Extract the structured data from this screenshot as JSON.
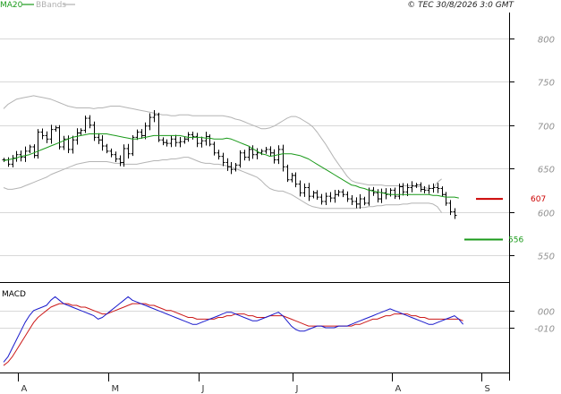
{
  "header": {
    "legend": [
      {
        "label": "MA20",
        "color": "#1a9a1a"
      },
      {
        "label": "BBands",
        "color": "#b0b0b0"
      }
    ],
    "copyright": "© TEC 30/8/2026 3:0 GMT"
  },
  "colors": {
    "ma20": "#1a9a1a",
    "bbands": "#b4b4b4",
    "candles": "#000000",
    "resistance": "#cc0000",
    "support": "#1a9a1a",
    "macd": "#1a1acc",
    "signal": "#cc1a1a",
    "grid": "#d8d8d8"
  },
  "chart_data": [
    {
      "type": "candlestick",
      "title": "",
      "ylim": [
        520,
        830
      ],
      "yticks": [
        "800",
        "750",
        "700",
        "650",
        "600",
        "550"
      ],
      "ytick_values": [
        800,
        750,
        700,
        650,
        600,
        550
      ],
      "grid": true,
      "x_months": [
        "A",
        "M",
        "J",
        "J",
        "A",
        "S"
      ],
      "month_index": [
        0,
        21,
        42,
        64,
        87,
        108
      ],
      "series": [
        {
          "name": "MA20",
          "values": [
            659,
            660,
            661,
            662,
            664,
            665,
            666,
            668,
            670,
            672,
            674,
            676,
            678,
            680,
            682,
            684,
            686,
            687,
            688,
            689,
            690,
            690,
            690,
            690,
            690,
            689,
            688,
            687,
            686,
            685,
            684,
            684,
            685,
            686,
            687,
            688,
            688,
            688,
            688,
            688,
            688,
            688,
            687,
            686,
            686,
            686,
            686,
            685,
            685,
            684,
            684,
            684,
            685,
            684,
            682,
            680,
            678,
            676,
            673,
            670,
            667,
            666,
            664,
            665,
            666,
            667,
            667,
            667,
            666,
            665,
            663,
            661,
            658,
            655,
            652,
            649,
            646,
            643,
            640,
            637,
            634,
            631,
            630,
            628,
            627,
            625,
            624,
            623,
            622,
            621,
            620,
            620,
            620,
            620,
            620,
            620,
            620,
            620,
            620,
            620,
            619,
            619,
            618,
            617,
            617,
            617,
            616
          ]
        },
        {
          "name": "BBands upper",
          "values": [
            719,
            724,
            727,
            730,
            731,
            732,
            733,
            734,
            733,
            732,
            731,
            730,
            728,
            726,
            724,
            722,
            721,
            720,
            720,
            720,
            720,
            719,
            720,
            720,
            721,
            722,
            722,
            722,
            721,
            720,
            719,
            718,
            717,
            716,
            715,
            714,
            713,
            712,
            712,
            711,
            711,
            712,
            712,
            712,
            711,
            711,
            711,
            711,
            711,
            711,
            711,
            711,
            710,
            709,
            707,
            706,
            704,
            702,
            700,
            698,
            696,
            696,
            697,
            699,
            702,
            705,
            708,
            710,
            710,
            708,
            705,
            702,
            698,
            692,
            685,
            678,
            670,
            662,
            655,
            648,
            641,
            636,
            634,
            633,
            632,
            631,
            631,
            631,
            631,
            630,
            630,
            630,
            630,
            630,
            630,
            630,
            629,
            629,
            628,
            627,
            627,
            634,
            638
          ]
        },
        {
          "name": "BBands lower",
          "values": [
            628,
            626,
            626,
            627,
            628,
            630,
            632,
            634,
            636,
            638,
            640,
            643,
            645,
            647,
            649,
            651,
            653,
            655,
            656,
            657,
            658,
            658,
            658,
            658,
            658,
            657,
            656,
            656,
            655,
            655,
            655,
            655,
            656,
            657,
            658,
            659,
            659,
            660,
            660,
            661,
            661,
            662,
            663,
            663,
            661,
            659,
            657,
            656,
            656,
            655,
            655,
            654,
            653,
            652,
            650,
            648,
            646,
            644,
            642,
            640,
            636,
            631,
            627,
            625,
            624,
            624,
            622,
            620,
            617,
            614,
            611,
            608,
            606,
            605,
            604,
            604,
            604,
            604,
            604,
            604,
            604,
            604,
            604,
            605,
            605,
            606,
            606,
            607,
            607,
            608,
            608,
            608,
            608,
            609,
            609,
            610,
            610,
            610,
            610,
            610,
            609,
            606,
            599
          ]
        },
        {
          "name": "Candles",
          "values": [
            660,
            655,
            662,
            666,
            663,
            670,
            675,
            665,
            692,
            688,
            684,
            695,
            697,
            675,
            684,
            672,
            683,
            691,
            694,
            708,
            700,
            686,
            683,
            676,
            670,
            666,
            661,
            657,
            673,
            667,
            686,
            692,
            688,
            699,
            709,
            712,
            683,
            680,
            679,
            684,
            680,
            681,
            684,
            689,
            687,
            679,
            682,
            687,
            678,
            668,
            664,
            657,
            652,
            649,
            654,
            668,
            663,
            672,
            666,
            668,
            670,
            672,
            668,
            660,
            672,
            652,
            637,
            642,
            632,
            622,
            628,
            618,
            622,
            617,
            612,
            618,
            616,
            620,
            623,
            620,
            615,
            612,
            609,
            615,
            610,
            625,
            622,
            615,
            622,
            620,
            625,
            618,
            629,
            623,
            628,
            630,
            631,
            626,
            625,
            627,
            628,
            627,
            620,
            610,
            600,
            596
          ]
        }
      ],
      "annotations": [
        {
          "label": "607",
          "value": 615,
          "color": "#cc0000"
        },
        {
          "label": "556",
          "value": 568,
          "color": "#1a9a1a"
        }
      ]
    },
    {
      "type": "line",
      "title": "MACD",
      "ylim": [
        -35,
        15
      ],
      "yticks": [
        "000",
        "-010"
      ],
      "ytick_values": [
        0,
        -10
      ],
      "grid": true,
      "series": [
        {
          "name": "",
          "values": [
            -30,
            -27,
            -22,
            -17,
            -12,
            -7,
            -3,
            0,
            1,
            2,
            3,
            6,
            8,
            6,
            4,
            3,
            2,
            1,
            0,
            -1,
            -2,
            -3,
            -5,
            -4,
            -2,
            0,
            2,
            4,
            6,
            8,
            6,
            5,
            4,
            3,
            2,
            1,
            0,
            -1,
            -2,
            -3,
            -4,
            -5,
            -6,
            -7,
            -8,
            -8,
            -7,
            -6,
            -5,
            -4,
            -3,
            -2,
            -1,
            -1,
            -2,
            -3,
            -4,
            -5,
            -6,
            -6,
            -5,
            -4,
            -3,
            -2,
            -1,
            -3,
            -6,
            -9,
            -11,
            -12,
            -12,
            -11,
            -10,
            -9,
            -9,
            -10,
            -10,
            -10,
            -9,
            -9,
            -9,
            -8,
            -7,
            -6,
            -5,
            -4,
            -3,
            -2,
            -1,
            0,
            1,
            0,
            -1,
            -2,
            -3,
            -4,
            -5,
            -6,
            -7,
            -8,
            -8,
            -7,
            -6,
            -5,
            -4,
            -3,
            -5,
            -8
          ]
        },
        {
          "name": "",
          "values": [
            -32,
            -30,
            -27,
            -23,
            -19,
            -15,
            -11,
            -7,
            -4,
            -2,
            0,
            2,
            3,
            4,
            4,
            4,
            3,
            3,
            2,
            2,
            1,
            0,
            -1,
            -2,
            -2,
            -1,
            0,
            1,
            2,
            3,
            4,
            4,
            4,
            4,
            3,
            3,
            2,
            1,
            0,
            0,
            -1,
            -2,
            -3,
            -4,
            -4,
            -5,
            -5,
            -5,
            -5,
            -5,
            -4,
            -4,
            -3,
            -3,
            -2,
            -2,
            -2,
            -3,
            -3,
            -4,
            -4,
            -4,
            -3,
            -3,
            -3,
            -3,
            -4,
            -5,
            -6,
            -7,
            -8,
            -9,
            -9,
            -9,
            -9,
            -9,
            -9,
            -9,
            -9,
            -9,
            -9,
            -9,
            -8,
            -8,
            -7,
            -6,
            -5,
            -5,
            -4,
            -3,
            -3,
            -2,
            -2,
            -2,
            -2,
            -3,
            -3,
            -4,
            -4,
            -5,
            -5,
            -5,
            -5,
            -5,
            -5,
            -5,
            -5,
            -6
          ]
        }
      ]
    }
  ]
}
